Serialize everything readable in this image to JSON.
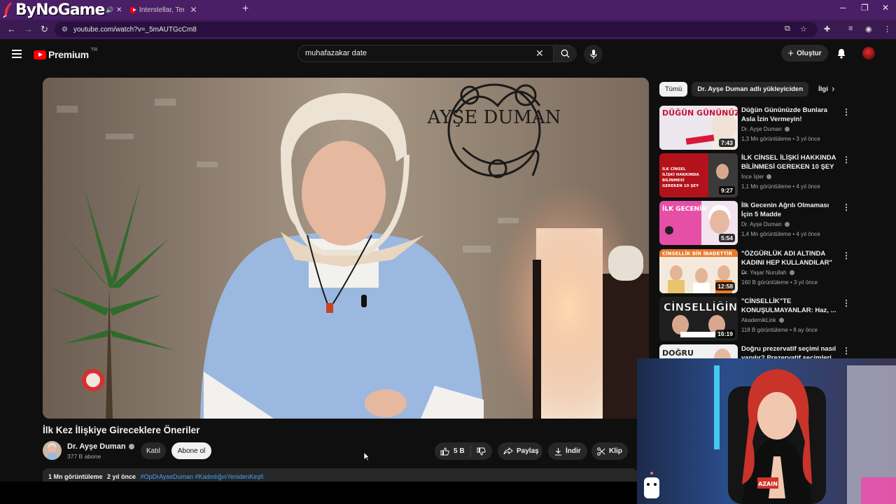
{
  "browser": {
    "logo_text": "ByNoGame",
    "tab_title": "Interstellar, Tenet, Terminator: Hangi filmi izlemeli",
    "url": "youtube.com/watch?v=_5mAUTGcCm8"
  },
  "youtube": {
    "brand": "Premium",
    "region": "TR",
    "search_query": "muhafazakar date",
    "create_label": "Oluştur"
  },
  "video": {
    "title": "İlk Kez İlişkiye Gireceklere Öneriler",
    "sign_text": "AYŞE DUMAN",
    "channel": "Dr. Ayşe Duman",
    "subscribers": "377 B abone",
    "join_label": "Katıl",
    "subscribe_label": "Abone ol",
    "likes": "5 B",
    "share_label": "Paylaş",
    "download_label": "İndir",
    "clip_label": "Klip",
    "views": "1 Mn görüntüleme",
    "age": "2 yıl önce",
    "hashtags": "#OpDrAyseDuman #KadınlığınYenidenKeşfi"
  },
  "chips": [
    "Tümü",
    "Dr. Ayşe Duman adlı yükleyiciden",
    "İlgili"
  ],
  "recommendations": [
    {
      "title": "Düğün Gününüzde Bunlara Asla İzin Vermeyin!",
      "channel": "Dr. Ayşe Duman",
      "meta": "1,3 Mn görüntüleme • 3 yıl önce",
      "duration": "7:43",
      "thumb_text": "DÜĞÜN GÜNÜNÜZDE",
      "color": "#e9e3ea"
    },
    {
      "title": "İLK CİNSEL İLİŞKİ HAKKINDA BİLİNMESİ GEREKEN 10 ŞEY",
      "channel": "İnce İşler",
      "meta": "1,1 Mn görüntüleme • 4 yıl önce",
      "duration": "9:27",
      "thumb_text": "İLK CİNSEL İLİŞKİ HAKKINDA BİLİNMESİ GEREKEN 10 ŞEY",
      "color": "#b3121a"
    },
    {
      "title": "İlk Gecenin Ağrılı Olmaması İçin 5 Madde",
      "channel": "Dr. Ayşe Duman",
      "meta": "1,4 Mn görüntüleme • 4 yıl önce",
      "duration": "5:54",
      "thumb_text": "İLK GECENİN",
      "color": "#e64fa6"
    },
    {
      "title": "\"ÖZGÜRLÜK ADI ALTINDA KADINI HEP KULLANDILAR\" ...",
      "channel": "Dr. Yaşar Nurullah",
      "meta": "160 B görüntüleme • 3 yıl önce",
      "duration": "12:58",
      "thumb_text": "CİNSELLİK BİR İBADETTİR",
      "color": "#f0a542"
    },
    {
      "title": "\"CİNSELLİK\"TE KONUŞULMAYANLAR: Haz, ...",
      "channel": "AkademikLink",
      "meta": "118 B görüntüleme • 8 ay önce",
      "duration": "16:19",
      "thumb_text": "CİNSELLİĞİN",
      "color": "#2a2a2a"
    },
    {
      "title": "Doğru prezervatif seçimi nasıl yapılır? Prezervatif seçimleri",
      "channel": "",
      "meta": "",
      "duration": "",
      "thumb_text": "DOĞRU",
      "color": "#f1f1f1"
    }
  ],
  "overlay": {
    "shirt_text": "AZAIN"
  }
}
